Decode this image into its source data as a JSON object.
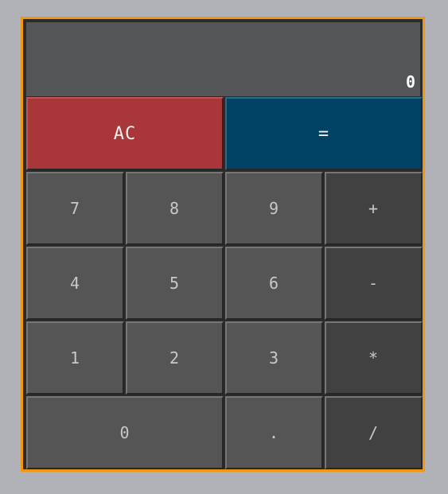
{
  "display": {
    "value": "0"
  },
  "buttons": {
    "ac": "AC",
    "equals": "=",
    "seven": "7",
    "eight": "8",
    "nine": "9",
    "plus": "+",
    "four": "4",
    "five": "5",
    "six": "6",
    "minus": "-",
    "one": "1",
    "two": "2",
    "three": "3",
    "multiply": "*",
    "zero": "0",
    "decimal": ".",
    "divide": "/"
  },
  "colors": {
    "frame_border": "#f2960f",
    "display_bg": "#545557",
    "ac_bg": "#a93638",
    "equals_bg": "#004264",
    "digit_bg": "#555556",
    "operator_bg": "#414142"
  }
}
